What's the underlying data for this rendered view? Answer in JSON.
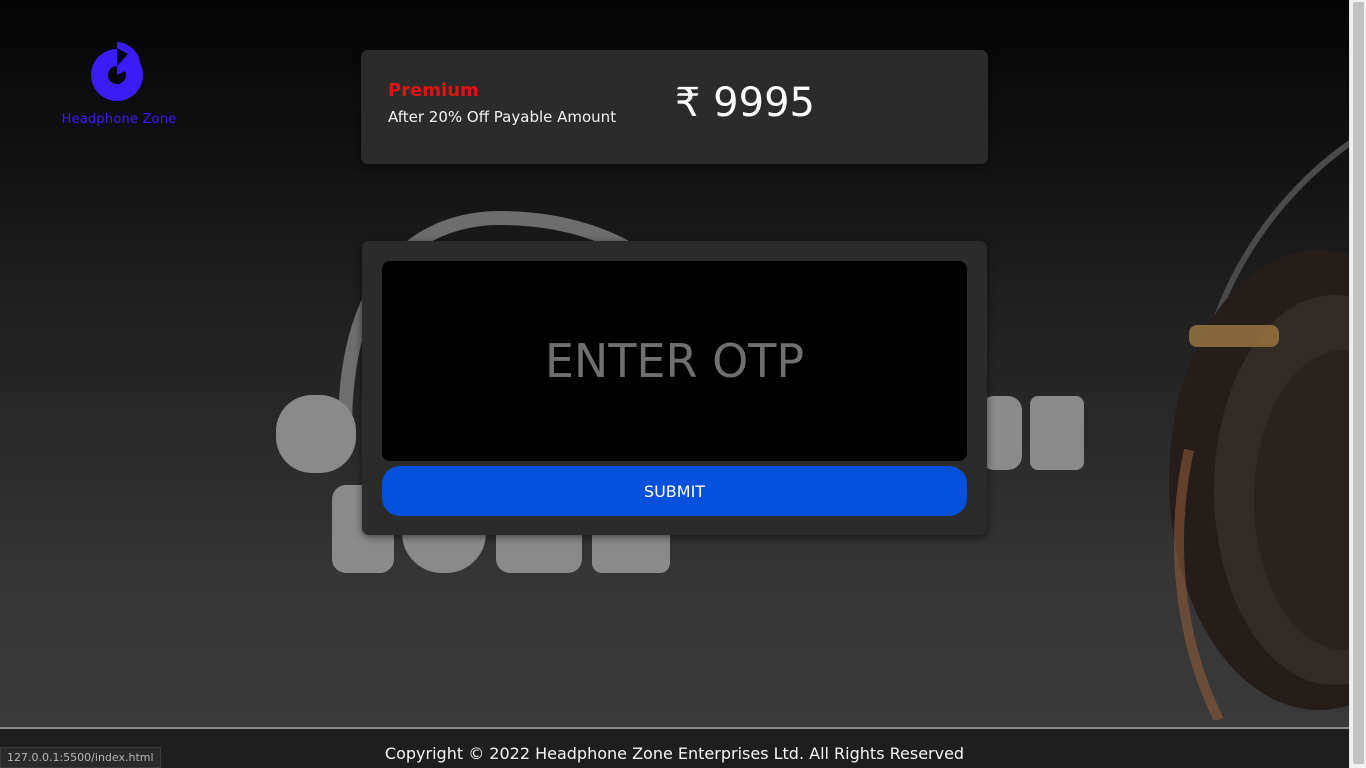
{
  "brand": {
    "name": "Headphone Zone",
    "logo_icon": "headphone-zone-logo-icon",
    "color": "#3b1cf5"
  },
  "plan": {
    "name": "Premium",
    "description": "After 20% Off Payable Amount",
    "price": "₹ 9995",
    "name_color": "#e01212"
  },
  "otp": {
    "placeholder": "ENTER OTP",
    "value": "",
    "submit_label": "SUBMIT",
    "button_color": "#0650dc"
  },
  "footer": {
    "copyright": "Copyright © 2022 Headphone Zone Enterprises Ltd. All Rights Reserved"
  },
  "status_bar": {
    "url": "127.0.0.1:5500/index.html"
  }
}
